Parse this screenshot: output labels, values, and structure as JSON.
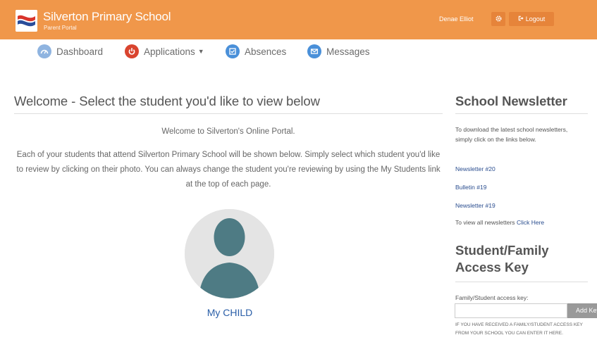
{
  "header": {
    "school_name": "Silverton Primary School",
    "portal_label": "Parent Portal",
    "user_name": "Denae Elliot",
    "logout_label": "Logout",
    "accent_color": "#f0974a"
  },
  "nav": {
    "items": [
      {
        "label": "Dashboard",
        "icon": "dashboard-icon"
      },
      {
        "label": "Applications",
        "icon": "power-icon",
        "has_dropdown": true
      },
      {
        "label": "Absences",
        "icon": "check-icon"
      },
      {
        "label": "Messages",
        "icon": "envelope-icon"
      }
    ]
  },
  "main": {
    "title": "Welcome - Select the student you'd like to view below",
    "welcome": "Welcome to Silverton's Online Portal.",
    "intro": "Each of your students that attend Silverton Primary School will be shown below. Simply select which student you'd like to review by clicking on their photo. You can always change the student you're reviewing by using the My Students link at the top of each page.",
    "students": [
      {
        "name": "My CHILD"
      }
    ]
  },
  "sidebar": {
    "newsletter_title": "School Newsletter",
    "newsletter_intro": "To download the latest school newsletters, simply click on the links below.",
    "links": [
      "Newsletter #20",
      "Bulletin #19",
      "Newsletter #19"
    ],
    "view_all_text": "To view all newsletters",
    "view_all_link": "Click Here",
    "access_title": "Student/Family Access Key",
    "access_label": "Family/Student access key:",
    "add_key_label": "Add Key",
    "access_note": "IF YOU HAVE RECEIVED A FAMILY/STUDENT ACCESS KEY FROM YOUR SCHOOL YOU CAN ENTER IT HERE."
  }
}
